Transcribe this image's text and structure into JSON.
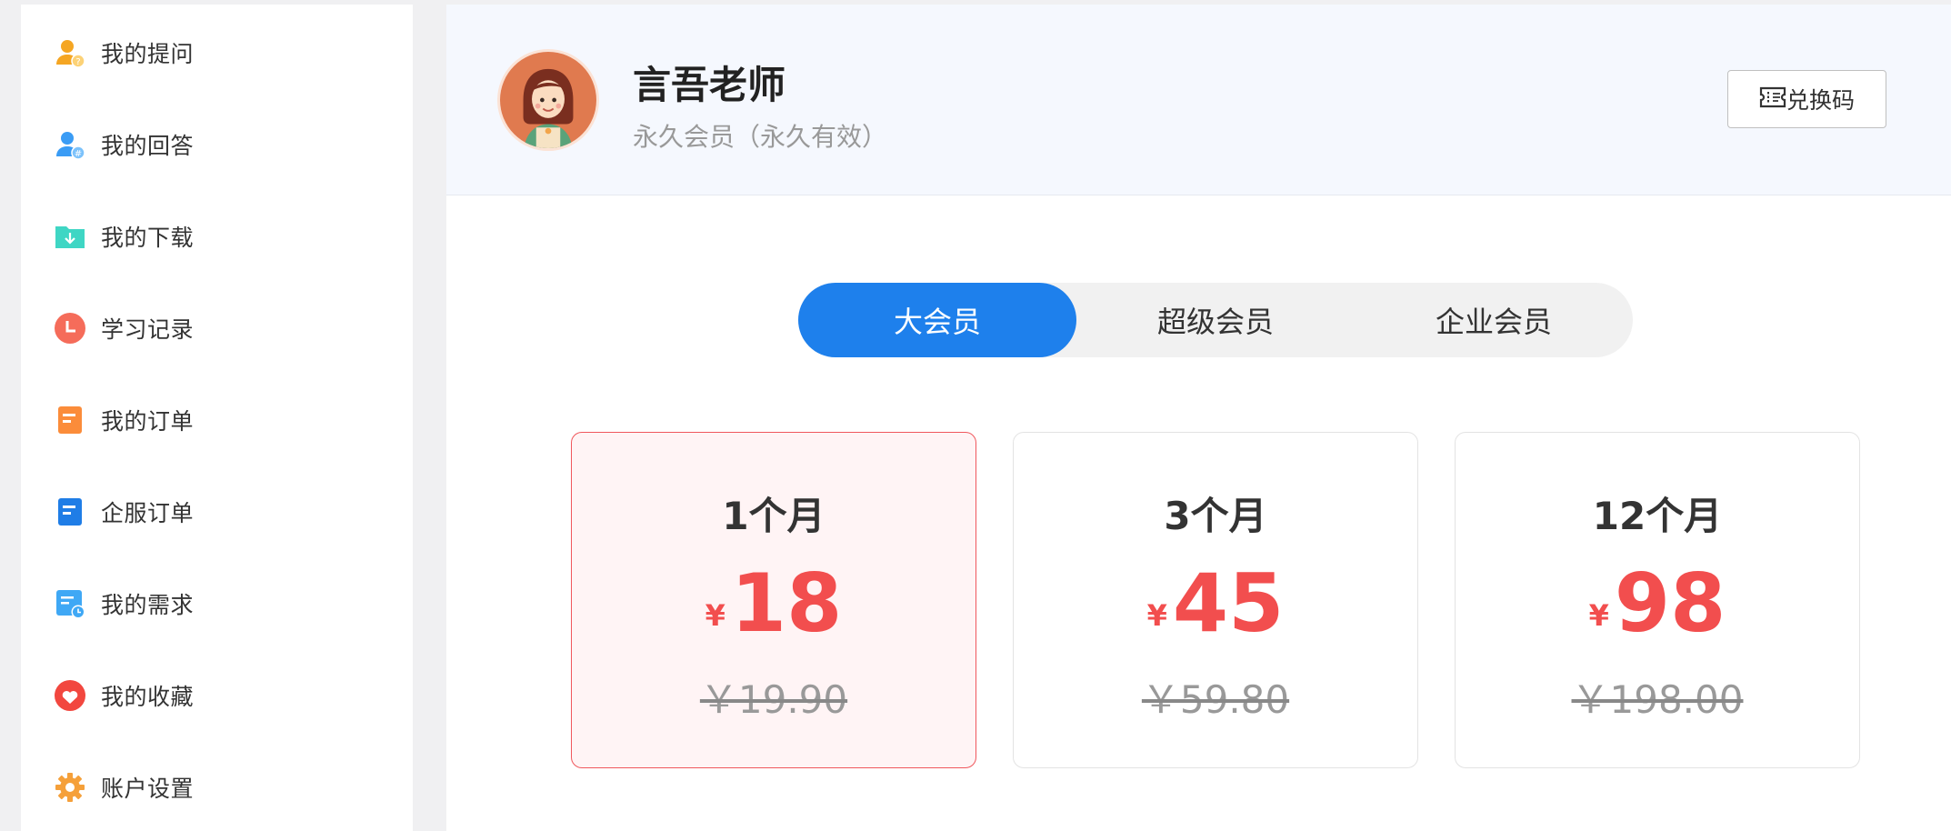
{
  "sidebar": {
    "items": [
      {
        "label": "我的提问",
        "icon": "user-question-icon",
        "color": "#f5a623"
      },
      {
        "label": "我的回答",
        "icon": "user-answer-icon",
        "color": "#3a9cf5"
      },
      {
        "label": "我的下载",
        "icon": "download-folder-icon",
        "color": "#3fd6c4"
      },
      {
        "label": "学习记录",
        "icon": "clock-icon",
        "color": "#f56c5a"
      },
      {
        "label": "我的订单",
        "icon": "order-doc-icon",
        "color": "#fb8c3a"
      },
      {
        "label": "企服订单",
        "icon": "enterprise-order-icon",
        "color": "#1f7de6"
      },
      {
        "label": "我的需求",
        "icon": "demand-calendar-icon",
        "color": "#3fa8f5"
      },
      {
        "label": "我的收藏",
        "icon": "heart-icon",
        "color": "#f2473f"
      },
      {
        "label": "账户设置",
        "icon": "gear-icon",
        "color": "#f5a03a"
      }
    ]
  },
  "profile": {
    "name": "言吾老师",
    "status": "永久会员（永久有效）",
    "redeem_label": "兑换码"
  },
  "tabs": [
    {
      "label": "大会员",
      "active": true
    },
    {
      "label": "超级会员",
      "active": false
    },
    {
      "label": "企业会员",
      "active": false
    }
  ],
  "plans": [
    {
      "duration": "1个月",
      "currency": "¥",
      "price": "18",
      "original": "￥19.90",
      "selected": true
    },
    {
      "duration": "3个月",
      "currency": "¥",
      "price": "45",
      "original": "￥59.80",
      "selected": false
    },
    {
      "duration": "12个月",
      "currency": "¥",
      "price": "98",
      "original": "￥198.00",
      "selected": false
    }
  ],
  "colors": {
    "accent": "#1e80ec",
    "price": "#f24e4e",
    "selected_border": "#f0575c",
    "selected_bg": "#fff4f5"
  }
}
